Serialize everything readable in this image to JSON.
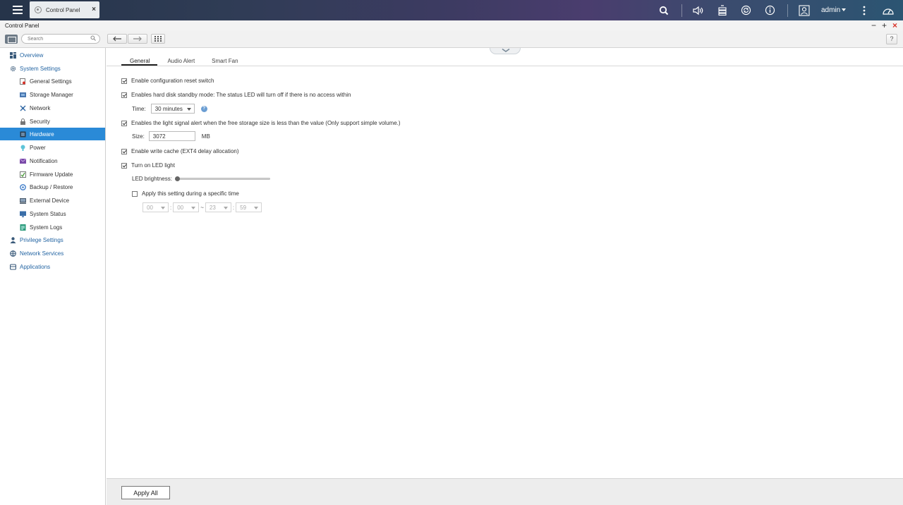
{
  "topbar": {
    "tab_title": "Control Panel",
    "tab_close": "×",
    "user": "admin",
    "icons": [
      "menu-icon",
      "search-icon",
      "volume-icon",
      "task-stack-icon",
      "sync-icon",
      "info-icon",
      "user-icon",
      "more-icon",
      "dashboard-icon"
    ]
  },
  "window": {
    "title": "Control Panel",
    "minimize": "−",
    "maximize": "+",
    "close": "×"
  },
  "toolbar": {
    "search_placeholder": "Search",
    "back": "←",
    "forward": "→",
    "help": "?"
  },
  "sidebar": {
    "items": [
      {
        "label": "Overview",
        "level": 0,
        "icon": "overview-icon"
      },
      {
        "label": "System Settings",
        "level": 0,
        "icon": "gear-icon"
      },
      {
        "label": "General Settings",
        "level": 1,
        "icon": "general-settings-icon"
      },
      {
        "label": "Storage Manager",
        "level": 1,
        "icon": "storage-icon"
      },
      {
        "label": "Network",
        "level": 1,
        "icon": "network-icon"
      },
      {
        "label": "Security",
        "level": 1,
        "icon": "lock-icon"
      },
      {
        "label": "Hardware",
        "level": 1,
        "icon": "hardware-icon",
        "active": true
      },
      {
        "label": "Power",
        "level": 1,
        "icon": "power-icon"
      },
      {
        "label": "Notification",
        "level": 1,
        "icon": "notification-icon"
      },
      {
        "label": "Firmware Update",
        "level": 1,
        "icon": "firmware-icon"
      },
      {
        "label": "Backup / Restore",
        "level": 1,
        "icon": "backup-icon"
      },
      {
        "label": "External Device",
        "level": 1,
        "icon": "external-device-icon"
      },
      {
        "label": "System Status",
        "level": 1,
        "icon": "system-status-icon"
      },
      {
        "label": "System Logs",
        "level": 1,
        "icon": "system-logs-icon"
      },
      {
        "label": "Privilege Settings",
        "level": 0,
        "icon": "privilege-icon"
      },
      {
        "label": "Network Services",
        "level": 0,
        "icon": "network-services-icon"
      },
      {
        "label": "Applications",
        "level": 0,
        "icon": "applications-icon"
      }
    ]
  },
  "tabs": [
    {
      "label": "General",
      "active": true
    },
    {
      "label": "Audio Alert"
    },
    {
      "label": "Smart Fan"
    }
  ],
  "settings": {
    "reset_switch": {
      "label": "Enable configuration reset switch",
      "checked": true
    },
    "standby": {
      "label": "Enables hard disk standby mode: The status LED will turn off if there is no access within",
      "checked": true
    },
    "time_label": "Time:",
    "time_value": "30 minutes",
    "signal_alert": {
      "label": "Enables the light signal alert when the free storage size is less than the value (Only support simple volume.)",
      "checked": true
    },
    "size_label": "Size:",
    "size_value": "3072",
    "size_unit": "MB",
    "write_cache": {
      "label": "Enable write cache (EXT4 delay allocation)",
      "checked": true
    },
    "led_light": {
      "label": "Turn on LED light",
      "checked": true
    },
    "led_brightness_label": "LED brightness:",
    "led_brightness_value": 0,
    "schedule": {
      "label": "Apply this setting during a specific time",
      "checked": false
    },
    "time_from_hour": "00",
    "time_from_min": "00",
    "time_sep": ":",
    "time_range_sep": "~",
    "time_to_hour": "23",
    "time_to_min": "59"
  },
  "footer": {
    "apply_all": "Apply All"
  },
  "colors": {
    "accent": "#2a8ad7",
    "link": "#2465a3",
    "close_red": "#d9342b"
  }
}
